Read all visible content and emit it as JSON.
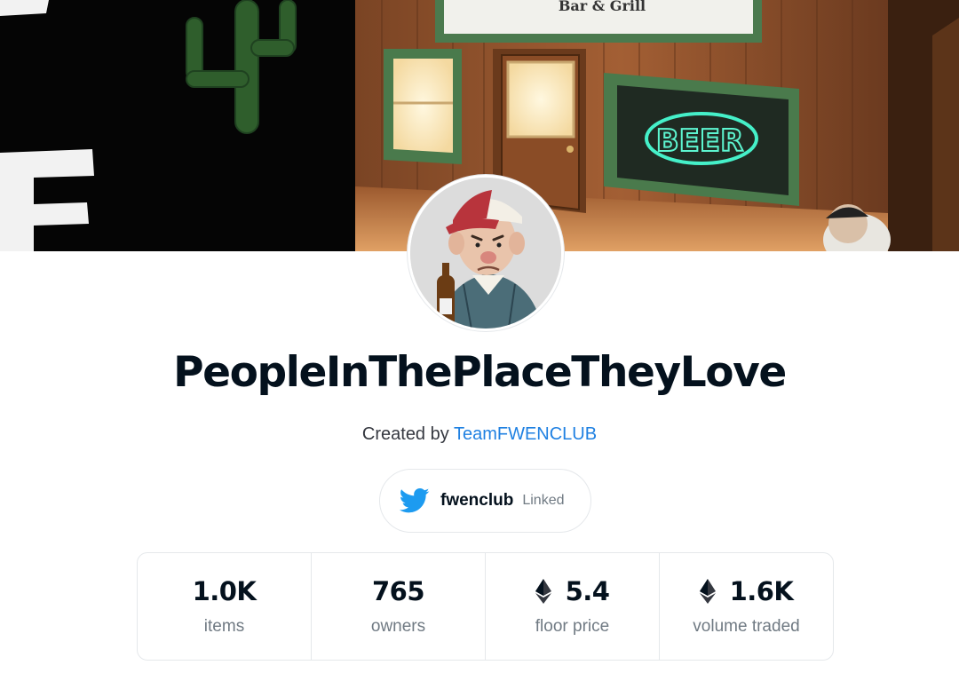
{
  "banner": {
    "sign_text": "Bar & Grill",
    "neon_text": "BEER"
  },
  "collection": {
    "title": "PeopleInThePlaceTheyLove",
    "created_by_prefix": "Created by",
    "creator": "TeamFWENCLUB"
  },
  "twitter": {
    "handle": "fwenclub",
    "status": "Linked",
    "icon": "twitter-bird-icon",
    "color": "#1d9bf0"
  },
  "stats": [
    {
      "value": "1.0K",
      "label": "items",
      "eth": false
    },
    {
      "value": "765",
      "label": "owners",
      "eth": false
    },
    {
      "value": "5.4",
      "label": "floor price",
      "eth": true
    },
    {
      "value": "1.6K",
      "label": "volume traded",
      "eth": true
    }
  ],
  "colors": {
    "link": "#2081e2",
    "text": "#04111d",
    "muted": "#707a83",
    "border": "#e5e8eb"
  }
}
